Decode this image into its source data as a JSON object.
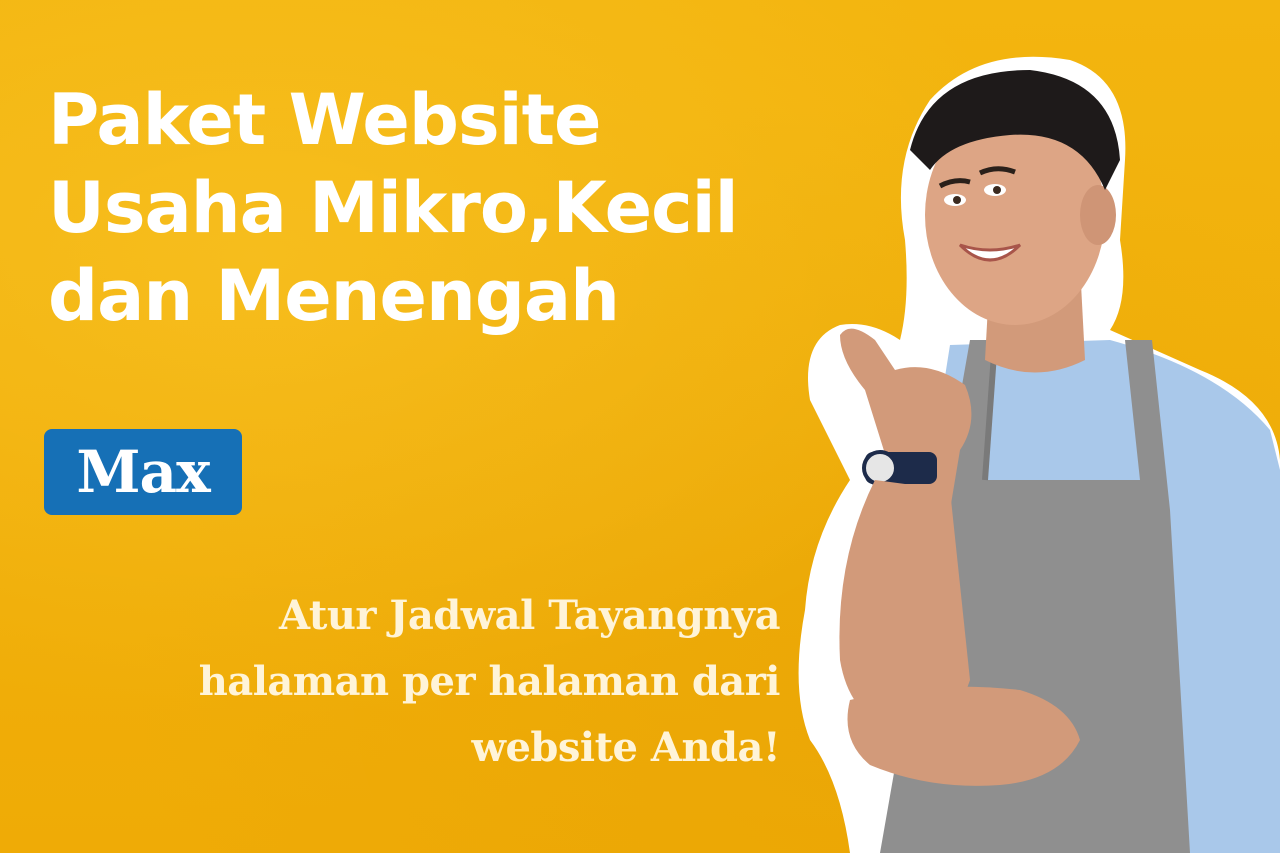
{
  "headline": {
    "line1": "Paket Website",
    "line2": "Usaha Mikro,Kecil",
    "line3": "dan Menengah"
  },
  "badge": {
    "label": "Max"
  },
  "subtext": {
    "line1": "Atur Jadwal Tayangnya",
    "line2": "halaman per halaman dari",
    "line3": "website Anda!"
  },
  "colors": {
    "background": "#f1b10a",
    "headline": "#ffffff",
    "badge": "#1670b6",
    "subtext": "#fff4d8",
    "shirt": "#a9c8ea",
    "apron": "#8f8f8f"
  },
  "image": {
    "subject": "smiling-man-in-apron-pointing-thumb"
  }
}
